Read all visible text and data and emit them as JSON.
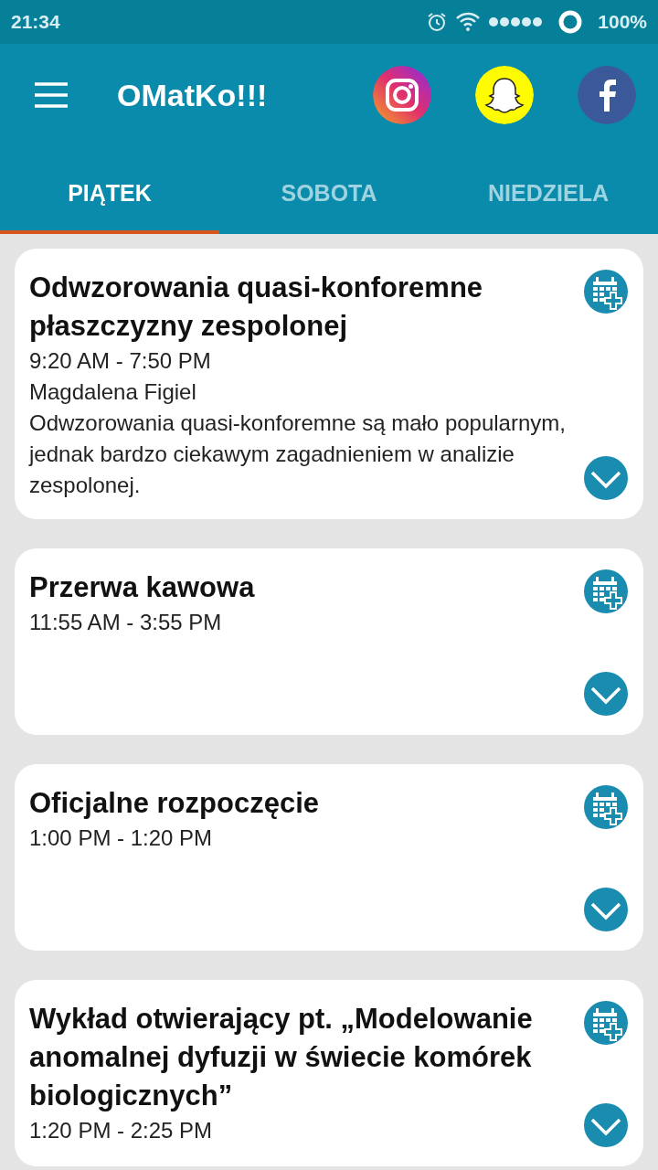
{
  "status_bar": {
    "time": "21:34",
    "battery": "100%"
  },
  "app_bar": {
    "title": "OMatKo!!!"
  },
  "tabs": [
    {
      "label": "PIĄTEK",
      "selected": true
    },
    {
      "label": "SOBOTA",
      "selected": false
    },
    {
      "label": "NIEDZIELA",
      "selected": false
    }
  ],
  "events": [
    {
      "title": "Odwzorowania quasi-konforemne płaszczyzny zespolonej",
      "time": "9:20 AM - 7:50 PM",
      "speaker": "Magdalena Figiel",
      "description": "Odwzorowania quasi-konforemne są mało popularnym, jednak bardzo ciekawym zagadnieniem w analizie zespolonej."
    },
    {
      "title": "Przerwa kawowa",
      "time": "11:55 AM - 3:55 PM"
    },
    {
      "title": "Oficjalne rozpoczęcie",
      "time": "1:00 PM - 1:20 PM"
    },
    {
      "title": "Wykład otwierający pt. „Modelowanie anomalnej dyfuzji w świecie komórek biologicznych”",
      "time": "1:20 PM - 2:25 PM"
    }
  ]
}
